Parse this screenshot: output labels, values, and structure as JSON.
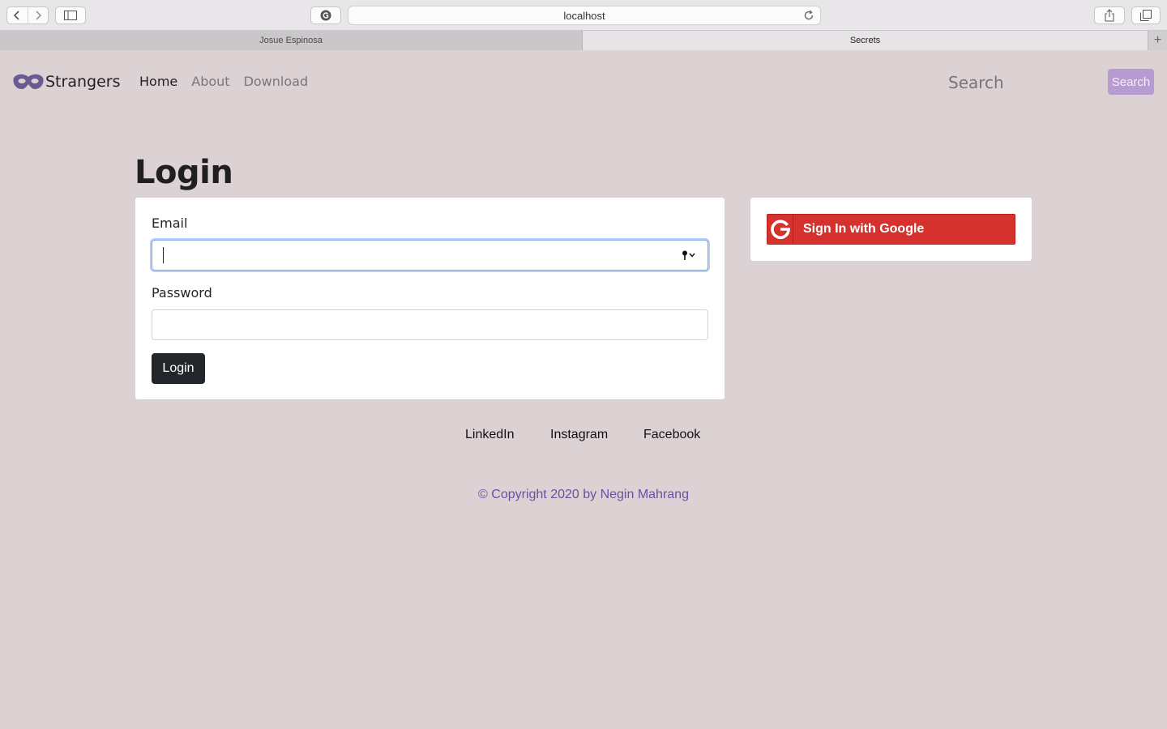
{
  "browser": {
    "url": "localhost",
    "tabs": [
      {
        "label": "Josue Espinosa",
        "active": false
      },
      {
        "label": "Secrets",
        "active": true
      }
    ]
  },
  "navbar": {
    "brand": "Strangers",
    "links": [
      {
        "label": "Home",
        "active": true
      },
      {
        "label": "About",
        "active": false
      },
      {
        "label": "Download",
        "active": false
      }
    ],
    "search_placeholder": "Search",
    "search_button": "Search"
  },
  "login": {
    "title": "Login",
    "email_label": "Email",
    "email_value": "",
    "password_label": "Password",
    "password_value": "",
    "submit_label": "Login"
  },
  "google": {
    "button_label": "Sign In with Google"
  },
  "footer": {
    "social": [
      "LinkedIn",
      "Instagram",
      "Facebook"
    ],
    "copyright": "© Copyright 2020 by Negin Mahrang"
  },
  "colors": {
    "page_bg": "#dcd2d4",
    "accent_purple": "#6e4ea0",
    "search_button_bg": "#b89bd0",
    "google_red": "#d6322d",
    "login_button_bg": "#23272b"
  }
}
